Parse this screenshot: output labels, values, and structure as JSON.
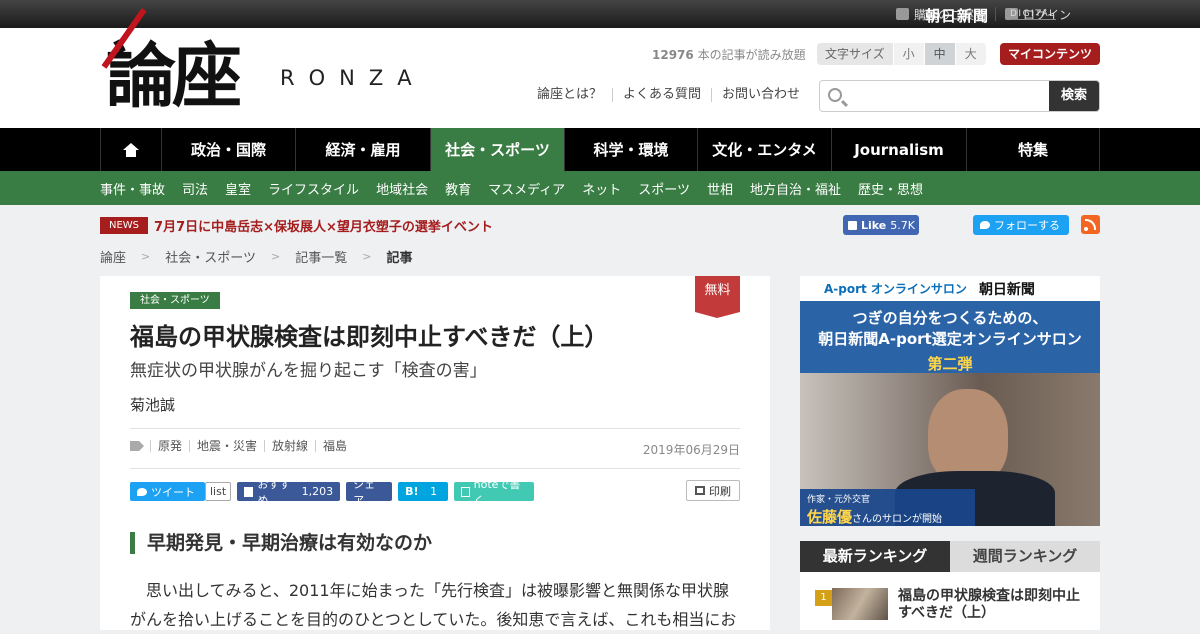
{
  "topbar": {
    "subscribe": "購読のご案内",
    "login": "ログイン",
    "asahi": "朝日新聞",
    "digital": "DIGITAL"
  },
  "header": {
    "logo": "論座",
    "logo_sub": "RONZA",
    "read_count": "12976",
    "read_suffix": "本の記事が読み放題",
    "font_size_label": "文字サイズ",
    "font_sizes": [
      "小",
      "中",
      "大"
    ],
    "font_size_selected": "中",
    "my_contents": "マイコンテンツ",
    "subnav": [
      "論座とは？",
      "よくある質問",
      "お問い合わせ"
    ],
    "search_placeholder": "",
    "search_button": "検索"
  },
  "main_nav": [
    "政治・国際",
    "経済・雇用",
    "社会・スポーツ",
    "科学・環境",
    "文化・エンタメ",
    "Journalism",
    "特集"
  ],
  "main_nav_active": "社会・スポーツ",
  "category_nav": [
    "事件・事故",
    "司法",
    "皇室",
    "ライフスタイル",
    "地域社会",
    "教育",
    "マスメディア",
    "ネット",
    "スポーツ",
    "世相",
    "地方自治・福祉",
    "歴史・思想"
  ],
  "news": {
    "tag": "NEWS",
    "text": "7月7日に中島岳志×保坂展人×望月衣塑子の選挙イベント"
  },
  "social_follow": {
    "fb_like": "Like",
    "fb_count": "5.7K",
    "twitter_follow": "フォローする"
  },
  "breadcrumb": [
    "論座",
    "社会・スポーツ",
    "記事一覧",
    "記事"
  ],
  "article": {
    "free_badge": "無料",
    "category": "社会・スポーツ",
    "title": "福島の甲状腺検査は即刻中止すべきだ（上）",
    "subtitle": "無症状の甲状腺がんを掘り起こす「検査の害」",
    "author": "菊池誠",
    "tags": [
      "原発",
      "地震・災害",
      "放射線",
      "福島"
    ],
    "date": "2019年06月29日",
    "share": {
      "tweet": "ツイート",
      "list": "list",
      "fb_recommend": "おすすめ",
      "fb_count": "1,203",
      "fb_share": "シェア",
      "hatena": "B!",
      "hatena_count": "1",
      "note": "noteで書く",
      "print": "印刷"
    },
    "heading": "早期発見・早期治療は有効なのか",
    "body": "思い出してみると、2011年に始まった「先行検査」は被曝影響と無関係な甲状腺がんを拾い上げることを目的のひとつとしていた。後知恵で言えば、これも相当にお"
  },
  "ad": {
    "aport": "A-port オンラインサロン",
    "asahi": "朝日新聞",
    "line1": "つぎの自分をつくるための、",
    "line2": "朝日新聞A-port選定オンラインサロン",
    "line3": "第二弾",
    "caption_role": "作家・元外交官",
    "caption_name": "佐藤優",
    "caption_suffix": "さんのサロンが開始"
  },
  "ranking": {
    "tabs": [
      "最新ランキング",
      "週間ランキング"
    ],
    "items": [
      {
        "rank": "1",
        "title": "福島の甲状腺検査は即刻中止すべきだ（上）"
      }
    ]
  }
}
